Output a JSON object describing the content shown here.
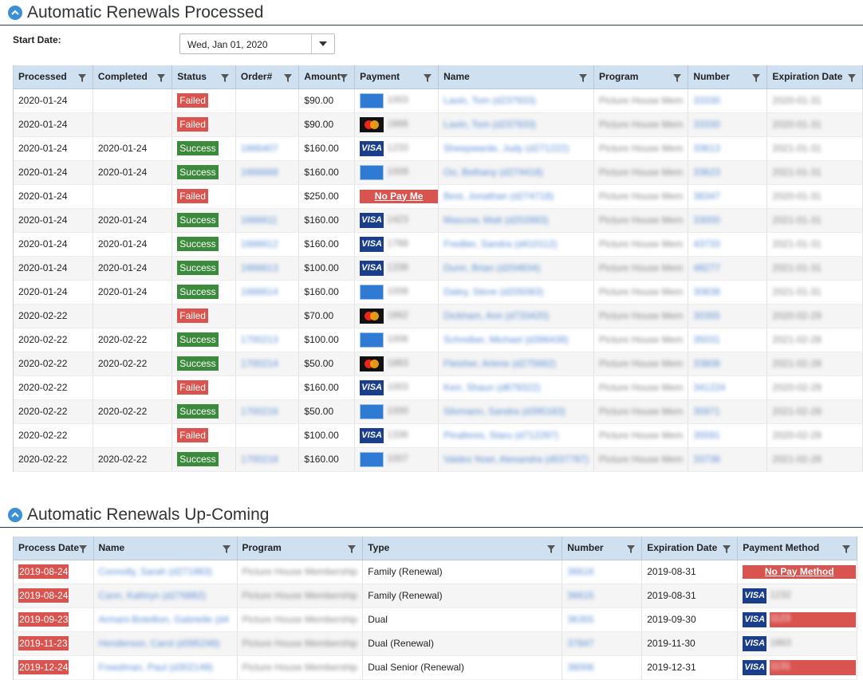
{
  "processed": {
    "title": "Automatic Renewals Processed",
    "start_date_label": "Start Date:",
    "start_date_value": "Wed, Jan 01, 2020",
    "columns": [
      "Processed",
      "Completed",
      "Status",
      "Order#",
      "Amount",
      "Payment",
      "Name",
      "Program",
      "Number",
      "Expiration Date"
    ],
    "rows": [
      {
        "processed": "2020-01-24",
        "completed": "",
        "status": "Failed",
        "order": "",
        "amount": "$90.00",
        "card": "amex",
        "card_last": "1003",
        "name": "Lavin, Tom (d237933)",
        "program": "Picture House Mem",
        "number": "33330",
        "exp": "2020-01-31"
      },
      {
        "processed": "2020-01-24",
        "completed": "",
        "status": "Failed",
        "order": "",
        "amount": "$90.00",
        "card": "mc",
        "card_last": "1666",
        "name": "Lavin, Tom (d237933)",
        "program": "Picture House Mem",
        "number": "33330",
        "exp": "2020-01-31"
      },
      {
        "processed": "2020-01-24",
        "completed": "2020-01-24",
        "status": "Success",
        "order": "1666407",
        "amount": "$160.00",
        "card": "visa",
        "card_last": "1233",
        "name": "Sheepwarde, Judy (d271222)",
        "program": "Picture House Mem",
        "number": "33613",
        "exp": "2021-01-31"
      },
      {
        "processed": "2020-01-24",
        "completed": "2020-01-24",
        "status": "Success",
        "order": "1666668",
        "amount": "$160.00",
        "card": "amex",
        "card_last": "1009",
        "name": "Oo, Bethany (d274418)",
        "program": "Picture House Mem",
        "number": "33623",
        "exp": "2021-01-31"
      },
      {
        "processed": "2020-01-24",
        "completed": "",
        "status": "Failed",
        "order": "",
        "amount": "$250.00",
        "card": "nopay",
        "card_last": "",
        "name": "Best, Jonathan (d274718)",
        "program": "Picture House Mem",
        "number": "38347",
        "exp": "2020-01-31"
      },
      {
        "processed": "2020-01-24",
        "completed": "2020-01-24",
        "status": "Success",
        "order": "1666611",
        "amount": "$160.00",
        "card": "visa",
        "card_last": "1423",
        "name": "Mascow, Matt (d202883)",
        "program": "Picture House Mem",
        "number": "33000",
        "exp": "2021-01-31"
      },
      {
        "processed": "2020-01-24",
        "completed": "2020-01-24",
        "status": "Success",
        "order": "1666612",
        "amount": "$160.00",
        "card": "visa",
        "card_last": "1788",
        "name": "Fredlier, Sandra (d410112)",
        "program": "Picture House Mem",
        "number": "43733",
        "exp": "2021-01-31"
      },
      {
        "processed": "2020-01-24",
        "completed": "2020-01-24",
        "status": "Success",
        "order": "1666613",
        "amount": "$100.00",
        "card": "visa",
        "card_last": "1338",
        "name": "Dunn, Brian (d204834)",
        "program": "Picture House Mem",
        "number": "48277",
        "exp": "2021-01-31"
      },
      {
        "processed": "2020-01-24",
        "completed": "2020-01-24",
        "status": "Success",
        "order": "1666614",
        "amount": "$160.00",
        "card": "amex",
        "card_last": "1008",
        "name": "Daley, Steve (d205083)",
        "program": "Picture House Mem",
        "number": "30838",
        "exp": "2021-01-31"
      },
      {
        "processed": "2020-02-22",
        "completed": "",
        "status": "Failed",
        "order": "",
        "amount": "$70.00",
        "card": "mc",
        "card_last": "1662",
        "name": "Dickham, Ann (d733420)",
        "program": "Picture House Mem",
        "number": "30355",
        "exp": "2020-02-29"
      },
      {
        "processed": "2020-02-22",
        "completed": "2020-02-22",
        "status": "Success",
        "order": "1700213",
        "amount": "$100.00",
        "card": "amex",
        "card_last": "1006",
        "name": "Schreiber, Michael (d396438)",
        "program": "Picture House Mem",
        "number": "35031",
        "exp": "2021-02-28"
      },
      {
        "processed": "2020-02-22",
        "completed": "2020-02-22",
        "status": "Success",
        "order": "1700214",
        "amount": "$50.00",
        "card": "mc",
        "card_last": "1883",
        "name": "Fleisher, Arlene (d275682)",
        "program": "Picture House Mem",
        "number": "33808",
        "exp": "2021-02-28"
      },
      {
        "processed": "2020-02-22",
        "completed": "",
        "status": "Failed",
        "order": "",
        "amount": "$160.00",
        "card": "visa",
        "card_last": "1003",
        "name": "Kerr, Shaun (d879322)",
        "program": "Picture House Mem",
        "number": "341224",
        "exp": "2020-02-29"
      },
      {
        "processed": "2020-02-22",
        "completed": "2020-02-22",
        "status": "Success",
        "order": "1700216",
        "amount": "$50.00",
        "card": "amex",
        "card_last": "1000",
        "name": "Silvmann, Sandra (d395183)",
        "program": "Picture House Mem",
        "number": "35971",
        "exp": "2021-02-28"
      },
      {
        "processed": "2020-02-22",
        "completed": "",
        "status": "Failed",
        "order": "",
        "amount": "$100.00",
        "card": "visa",
        "card_last": "1336",
        "name": "Pinaferes, Staru (d712287)",
        "program": "Picture House Mem",
        "number": "35591",
        "exp": "2020-02-29"
      },
      {
        "processed": "2020-02-22",
        "completed": "2020-02-22",
        "status": "Success",
        "order": "1700218",
        "amount": "$160.00",
        "card": "amex",
        "card_last": "1007",
        "name": "Valdez Noel, Alexandra (d537787)",
        "program": "Picture House Mem",
        "number": "33738",
        "exp": "2021-02-28"
      }
    ],
    "no_pay_label": "No Pay Me"
  },
  "upcoming": {
    "title": "Automatic Renewals Up-Coming",
    "columns": [
      "Process Date",
      "Name",
      "Program",
      "Type",
      "Number",
      "Expiration Date",
      "Payment Method"
    ],
    "rows": [
      {
        "process": "2019-08-24",
        "name": "Connolly, Sarah (d271983)",
        "program": "Picture House Membership",
        "type": "Family (Renewal)",
        "number": "36616",
        "exp": "2019-08-31",
        "pay": "nopay",
        "pay_last": ""
      },
      {
        "process": "2019-08-24",
        "name": "Cann, Kathryn (d276882)",
        "program": "Picture House Membership",
        "type": "Family (Renewal)",
        "number": "36615",
        "exp": "2019-08-31",
        "pay": "visa",
        "pay_last": "1232"
      },
      {
        "process": "2019-09-23",
        "name": "Armani-Botellion, Gabrielle (d4",
        "program": "Picture House Membership",
        "type": "Dual",
        "number": "36355",
        "exp": "2019-09-30",
        "pay": "visa-red",
        "pay_last": "1123"
      },
      {
        "process": "2019-11-23",
        "name": "Henderson, Carol (d395248)",
        "program": "Picture House Membership",
        "type": "Dual (Renewal)",
        "number": "37847",
        "exp": "2019-11-30",
        "pay": "visa",
        "pay_last": "1863"
      },
      {
        "process": "2019-12-24",
        "name": "Freedman, Paul (d302149)",
        "program": "Picture House Membership",
        "type": "Dual Senior (Renewal)",
        "number": "38006",
        "exp": "2019-12-31",
        "pay": "visa-red",
        "pay_last": "1131"
      }
    ],
    "no_pay_label": "No Pay Method"
  },
  "colors": {
    "header_bg": "#cfe0f1",
    "failed": "#d9534f",
    "success": "#3c8a3c",
    "accent": "#3a8fd6"
  }
}
